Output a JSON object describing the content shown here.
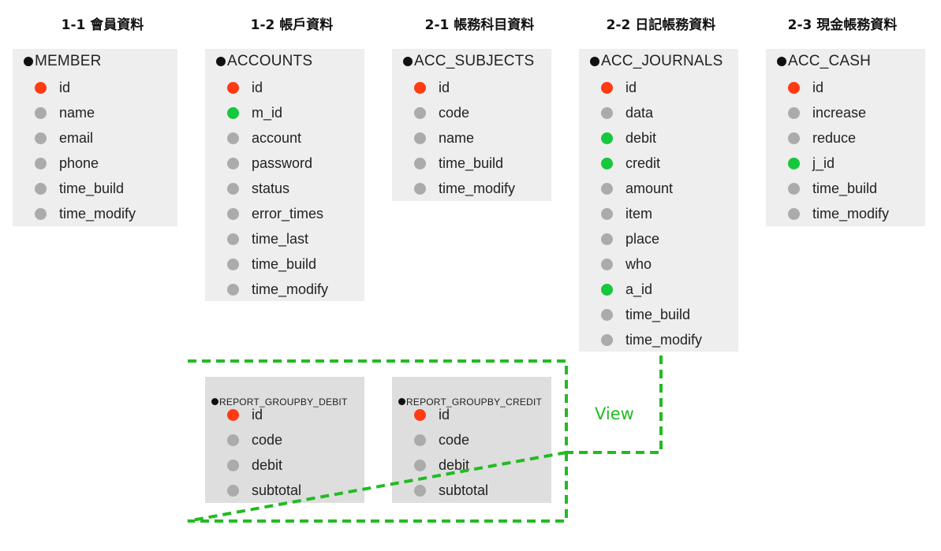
{
  "headings": [
    "1-1 會員資料",
    "1-2 帳戶資料",
    "2-1 帳務科目資料",
    "2-2 日記帳務資料",
    "2-3 現金帳務資料"
  ],
  "key_colors": {
    "primary": "#ff3b14",
    "foreign": "#16c83c",
    "column": "#ababab"
  },
  "tables": [
    {
      "name": "MEMBER",
      "fields": [
        {
          "label": "id",
          "type": "primary"
        },
        {
          "label": "name",
          "type": "column"
        },
        {
          "label": "email",
          "type": "column"
        },
        {
          "label": "phone",
          "type": "column"
        },
        {
          "label": "time_build",
          "type": "column"
        },
        {
          "label": "time_modify",
          "type": "column"
        }
      ]
    },
    {
      "name": "ACCOUNTS",
      "fields": [
        {
          "label": "id",
          "type": "primary"
        },
        {
          "label": "m_id",
          "type": "foreign"
        },
        {
          "label": "account",
          "type": "column"
        },
        {
          "label": "password",
          "type": "column"
        },
        {
          "label": "status",
          "type": "column"
        },
        {
          "label": "error_times",
          "type": "column"
        },
        {
          "label": "time_last",
          "type": "column"
        },
        {
          "label": "time_build",
          "type": "column"
        },
        {
          "label": "time_modify",
          "type": "column"
        }
      ]
    },
    {
      "name": "ACC_SUBJECTS",
      "fields": [
        {
          "label": "id",
          "type": "primary"
        },
        {
          "label": "code",
          "type": "column"
        },
        {
          "label": "name",
          "type": "column"
        },
        {
          "label": "time_build",
          "type": "column"
        },
        {
          "label": "time_modify",
          "type": "column"
        }
      ]
    },
    {
      "name": "ACC_JOURNALS",
      "fields": [
        {
          "label": "id",
          "type": "primary"
        },
        {
          "label": "data",
          "type": "column"
        },
        {
          "label": "debit",
          "type": "foreign"
        },
        {
          "label": "credit",
          "type": "foreign"
        },
        {
          "label": "amount",
          "type": "column"
        },
        {
          "label": "item",
          "type": "column"
        },
        {
          "label": "place",
          "type": "column"
        },
        {
          "label": "who",
          "type": "column"
        },
        {
          "label": "a_id",
          "type": "foreign"
        },
        {
          "label": "time_build",
          "type": "column"
        },
        {
          "label": "time_modify",
          "type": "column"
        }
      ]
    },
    {
      "name": "ACC_CASH",
      "fields": [
        {
          "label": "id",
          "type": "primary"
        },
        {
          "label": "increase",
          "type": "column"
        },
        {
          "label": "reduce",
          "type": "column"
        },
        {
          "label": "j_id",
          "type": "foreign"
        },
        {
          "label": "time_build",
          "type": "column"
        },
        {
          "label": "time_modify",
          "type": "column"
        }
      ]
    }
  ],
  "views": [
    {
      "name": "REPORT_GROUPBY_DEBIT",
      "fields": [
        {
          "label": "id",
          "type": "primary"
        },
        {
          "label": "code",
          "type": "column"
        },
        {
          "label": "debit",
          "type": "column"
        },
        {
          "label": "subtotal",
          "type": "column"
        }
      ]
    },
    {
      "name": "REPORT_GROUPBY_CREDIT",
      "fields": [
        {
          "label": "id",
          "type": "primary"
        },
        {
          "label": "code",
          "type": "column"
        },
        {
          "label": "debit",
          "type": "column"
        },
        {
          "label": "subtotal",
          "type": "column"
        }
      ]
    }
  ],
  "view_label": "View",
  "view_border_color": "#22bb22"
}
